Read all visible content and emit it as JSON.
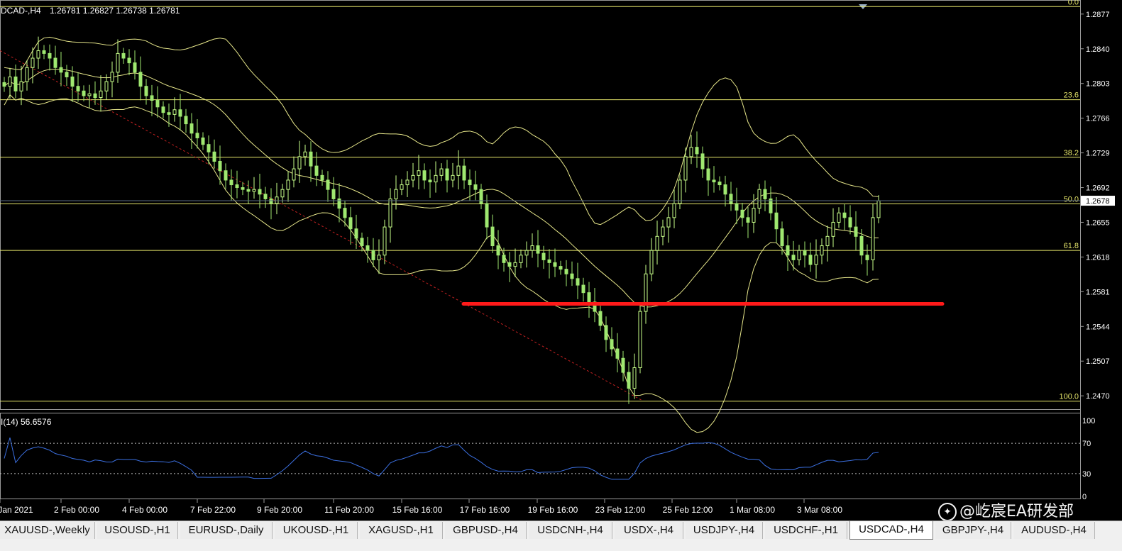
{
  "header": {
    "symbol": "DCAD-,H4",
    "ohlc": "1.26781 1.26827 1.26738 1.26781"
  },
  "price_axis": {
    "labels": [
      "1.2877",
      "1.2840",
      "1.2803",
      "1.2766",
      "1.2729",
      "1.2692",
      "1.2655",
      "1.2618",
      "1.2581",
      "1.2544",
      "1.2507",
      "1.2470"
    ],
    "current_price": "1.2678"
  },
  "fibonacci": {
    "levels": [
      {
        "label": "0.0",
        "price": 1.2885
      },
      {
        "label": "23.6",
        "price": 1.27857
      },
      {
        "label": "38.2",
        "price": 1.27243
      },
      {
        "label": "50.0",
        "price": 1.26746
      },
      {
        "label": "61.8",
        "price": 1.2625
      },
      {
        "label": "100.0",
        "price": 1.24643
      }
    ]
  },
  "support_line": {
    "price": 1.2568,
    "color": "#ff1a1a"
  },
  "trendline": {
    "color": "#c02020",
    "start_price": 1.2838,
    "end_price": 1.2465
  },
  "rsi": {
    "label": "I(14) 56.6576",
    "axis_labels": [
      "100",
      "70",
      "30",
      "0"
    ],
    "levels": [
      70,
      30
    ],
    "color": "#3b6fe0"
  },
  "time_axis": {
    "labels": [
      "Jan 2021",
      "2 Feb 00:00",
      "4 Feb 00:00",
      "7 Feb 22:00",
      "9 Feb 20:00",
      "11 Feb 20:00",
      "15 Feb 16:00",
      "17 Feb 16:00",
      "19 Feb 16:00",
      "23 Feb 12:00",
      "25 Feb 12:00",
      "1 Mar 08:00",
      "3 Mar 08:00"
    ]
  },
  "tabs": [
    {
      "label": "XAUUSD-,Weekly",
      "active": false
    },
    {
      "label": "USOUSD-,H1",
      "active": false
    },
    {
      "label": "EURUSD-,Daily",
      "active": false
    },
    {
      "label": "UKOUSD-,H1",
      "active": false
    },
    {
      "label": "XAGUSD-,H1",
      "active": false
    },
    {
      "label": "GBPUSD-,H4",
      "active": false
    },
    {
      "label": "USDCNH-,H4",
      "active": false
    },
    {
      "label": "USDX-,H4",
      "active": false
    },
    {
      "label": "USDJPY-,H4",
      "active": false
    },
    {
      "label": "USDCHF-,H1",
      "active": false
    },
    {
      "label": "USDCAD-,H4",
      "active": true
    },
    {
      "label": "GBPJPY-,H4",
      "active": false
    },
    {
      "label": "AUDUSD-,H4",
      "active": false
    }
  ],
  "watermark": {
    "text": "@屹宸EA研发部",
    "icon": "weibo-icon"
  },
  "colors": {
    "candle_up": "#c8ff8a",
    "candle_down": "#9fe870",
    "bands": "#e6e68a",
    "fib": "#e6e66a",
    "grid_text": "#ffffff",
    "background": "#000000"
  },
  "chart_data": {
    "type": "candlestick",
    "symbol": "USDCAD",
    "timeframe": "H4",
    "ylim": [
      1.2455,
      1.2892
    ],
    "close_path": [
      1.28,
      1.281,
      1.2795,
      1.2805,
      1.282,
      1.283,
      1.2838,
      1.2835,
      1.283,
      1.282,
      1.2815,
      1.281,
      1.28,
      1.2795,
      1.279,
      1.2792,
      1.2788,
      1.2795,
      1.2805,
      1.2815,
      1.2835,
      1.283,
      1.2825,
      1.2815,
      1.28,
      1.279,
      1.2785,
      1.2778,
      1.2772,
      1.277,
      1.2775,
      1.2768,
      1.276,
      1.275,
      1.2745,
      1.2738,
      1.273,
      1.272,
      1.271,
      1.27,
      1.2695,
      1.2692,
      1.269,
      1.2688,
      1.269,
      1.2685,
      1.268,
      1.2675,
      1.2682,
      1.269,
      1.27,
      1.2712,
      1.2725,
      1.273,
      1.2715,
      1.2705,
      1.27,
      1.269,
      1.268,
      1.267,
      1.266,
      1.2648,
      1.2638,
      1.263,
      1.2625,
      1.2615,
      1.262,
      1.265,
      1.268,
      1.269,
      1.2695,
      1.27,
      1.2705,
      1.271,
      1.27,
      1.2698,
      1.2705,
      1.2712,
      1.27,
      1.2705,
      1.2715,
      1.27,
      1.2695,
      1.269,
      1.2675,
      1.265,
      1.263,
      1.262,
      1.2612,
      1.2608,
      1.2612,
      1.262,
      1.2625,
      1.263,
      1.2622,
      1.2615,
      1.2612,
      1.2608,
      1.2605,
      1.26,
      1.2595,
      1.2588,
      1.258,
      1.257,
      1.256,
      1.2545,
      1.253,
      1.252,
      1.251,
      1.2495,
      1.2478,
      1.25,
      1.256,
      1.26,
      1.2625,
      1.264,
      1.265,
      1.266,
      1.2675,
      1.27,
      1.2725,
      1.2735,
      1.2728,
      1.2712,
      1.27,
      1.2698,
      1.2695,
      1.2685,
      1.2675,
      1.2668,
      1.266,
      1.2655,
      1.267,
      1.269,
      1.268,
      1.2665,
      1.2648,
      1.263,
      1.262,
      1.2615,
      1.2625,
      1.262,
      1.261,
      1.262,
      1.263,
      1.264,
      1.2655,
      1.2665,
      1.266,
      1.265,
      1.264,
      1.262,
      1.2615,
      1.266,
      1.2678
    ]
  }
}
